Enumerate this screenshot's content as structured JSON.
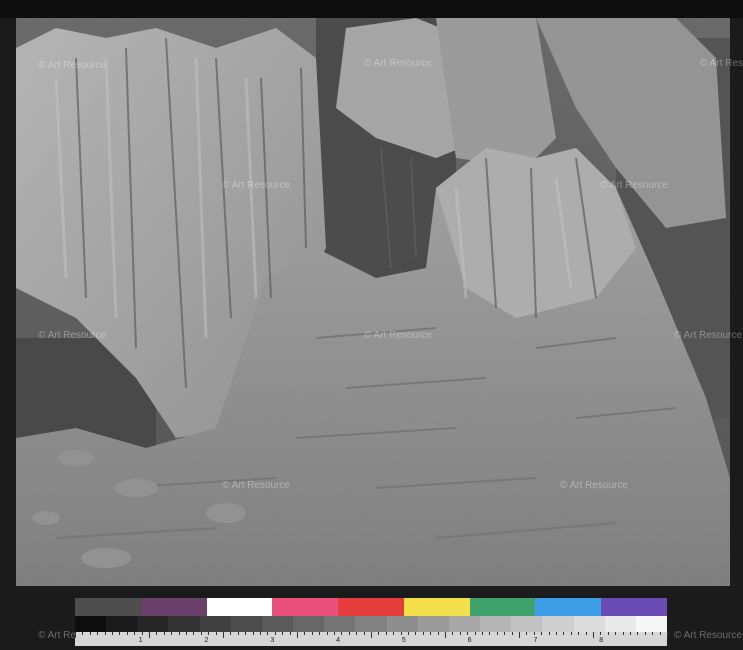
{
  "watermark_text": "© Art Resource",
  "colors": {
    "swatches": [
      "#4d4d4d",
      "#6a3f6a",
      "#ffffff",
      "#e94f7a",
      "#e53c3c",
      "#f4e04a",
      "#3fa26d",
      "#3b9ee6",
      "#6a4bb3"
    ],
    "grays": [
      "#0e0e0e",
      "#1a1a1a",
      "#262626",
      "#333333",
      "#404040",
      "#4d4d4d",
      "#5a5a5a",
      "#676767",
      "#747474",
      "#818181",
      "#8e8e8e",
      "#9b9b9b",
      "#a8a8a8",
      "#b5b5b5",
      "#c2c2c2",
      "#cfcfcf",
      "#dcdcdc",
      "#e9e9e9",
      "#f6f6f6"
    ]
  },
  "ruler_numbers": [
    "1",
    "2",
    "3",
    "4",
    "5",
    "6",
    "7",
    "8"
  ]
}
